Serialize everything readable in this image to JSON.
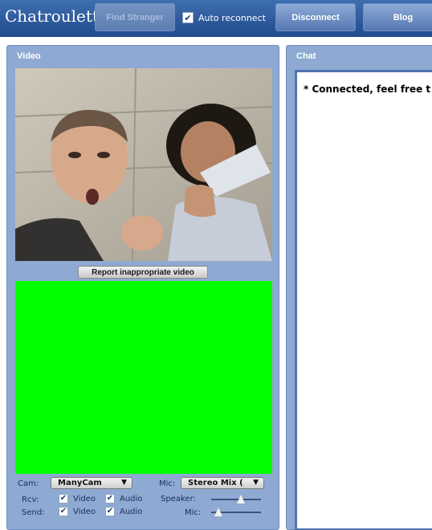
{
  "topbar": {
    "app_title": "Chatroulette",
    "find_stranger_label": "Find Stranger",
    "auto_reconnect_label": "Auto reconnect",
    "auto_reconnect_checked": true,
    "disconnect_label": "Disconnect",
    "blog_label": "Blog",
    "colors": {
      "bar": "#2f5a9c",
      "button": "#6f8fc6"
    }
  },
  "video_panel": {
    "title": "Video",
    "report_label": "Report inappropriate video",
    "self_video_color": "#00ff00",
    "cam": {
      "label": "Cam:",
      "value": "ManyCam"
    },
    "mic": {
      "label": "Mic:",
      "value": "Stereo Mix ("
    },
    "rcv": {
      "label": "Rcv:",
      "video_label": "Video",
      "audio_label": "Audio",
      "video_checked": true,
      "audio_checked": true
    },
    "send": {
      "label": "Send:",
      "video_label": "Video",
      "audio_label": "Audio",
      "video_checked": true,
      "audio_checked": true
    },
    "speaker": {
      "label": "Speaker:",
      "level": 0.62
    },
    "mic_level": {
      "label": "Mic:",
      "level": 0.08
    }
  },
  "chat_panel": {
    "title": "Chat",
    "messages": [
      "* Connected, feel free t"
    ]
  }
}
